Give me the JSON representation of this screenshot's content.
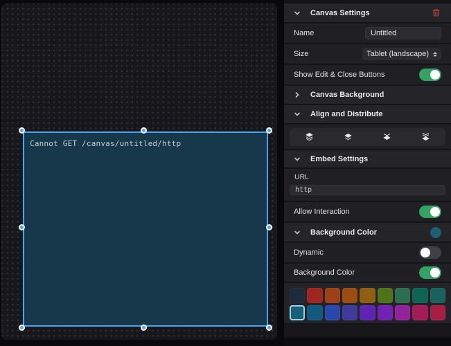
{
  "canvas": {
    "selected_element": {
      "error_text": "Cannot GET /canvas/untitled/http",
      "fill": "#16384a",
      "selection_color": "#4da3f2"
    }
  },
  "panel": {
    "canvas_settings": {
      "title": "Canvas Settings",
      "collapsed": false,
      "delete_icon": "trash-icon",
      "delete_color": "#b5443a",
      "name": {
        "label": "Name",
        "value": "Untitled"
      },
      "size": {
        "label": "Size",
        "value": "Tablet (landscape)"
      },
      "show_edit": {
        "label": "Show Edit & Close Buttons",
        "on": true
      }
    },
    "canvas_background": {
      "title": "Canvas Background",
      "collapsed": true
    },
    "align_distribute": {
      "title": "Align and Distribute",
      "collapsed": false,
      "buttons": [
        "bring-to-front",
        "bring-forward",
        "send-backward",
        "send-to-back"
      ]
    },
    "embed_settings": {
      "title": "Embed Settings",
      "collapsed": false,
      "url": {
        "label": "URL",
        "value": "http"
      },
      "allow_interaction": {
        "label": "Allow Interaction",
        "on": true
      }
    },
    "background_color": {
      "title": "Background Color",
      "collapsed": false,
      "current": "#1d5d75",
      "dynamic": {
        "label": "Dynamic",
        "on": false
      },
      "enabled": {
        "label": "Background Color",
        "on": true
      },
      "swatch_rows": [
        [
          "#1f2a3a",
          "#9e2621",
          "#9f4117",
          "#9b4d13",
          "#8f5d13",
          "#4d7418",
          "#2e6e4e",
          "#0f6355",
          "#19625d"
        ],
        [
          "#1a5f78",
          "#11597f",
          "#2a47ac",
          "#3f3a9c",
          "#5c26b3",
          "#7122b3",
          "#93229c",
          "#a21d58",
          "#a71e43"
        ]
      ],
      "selected": {
        "row": 1,
        "col": 0
      }
    },
    "accent": {
      "toggle_on": "#34a361"
    }
  }
}
